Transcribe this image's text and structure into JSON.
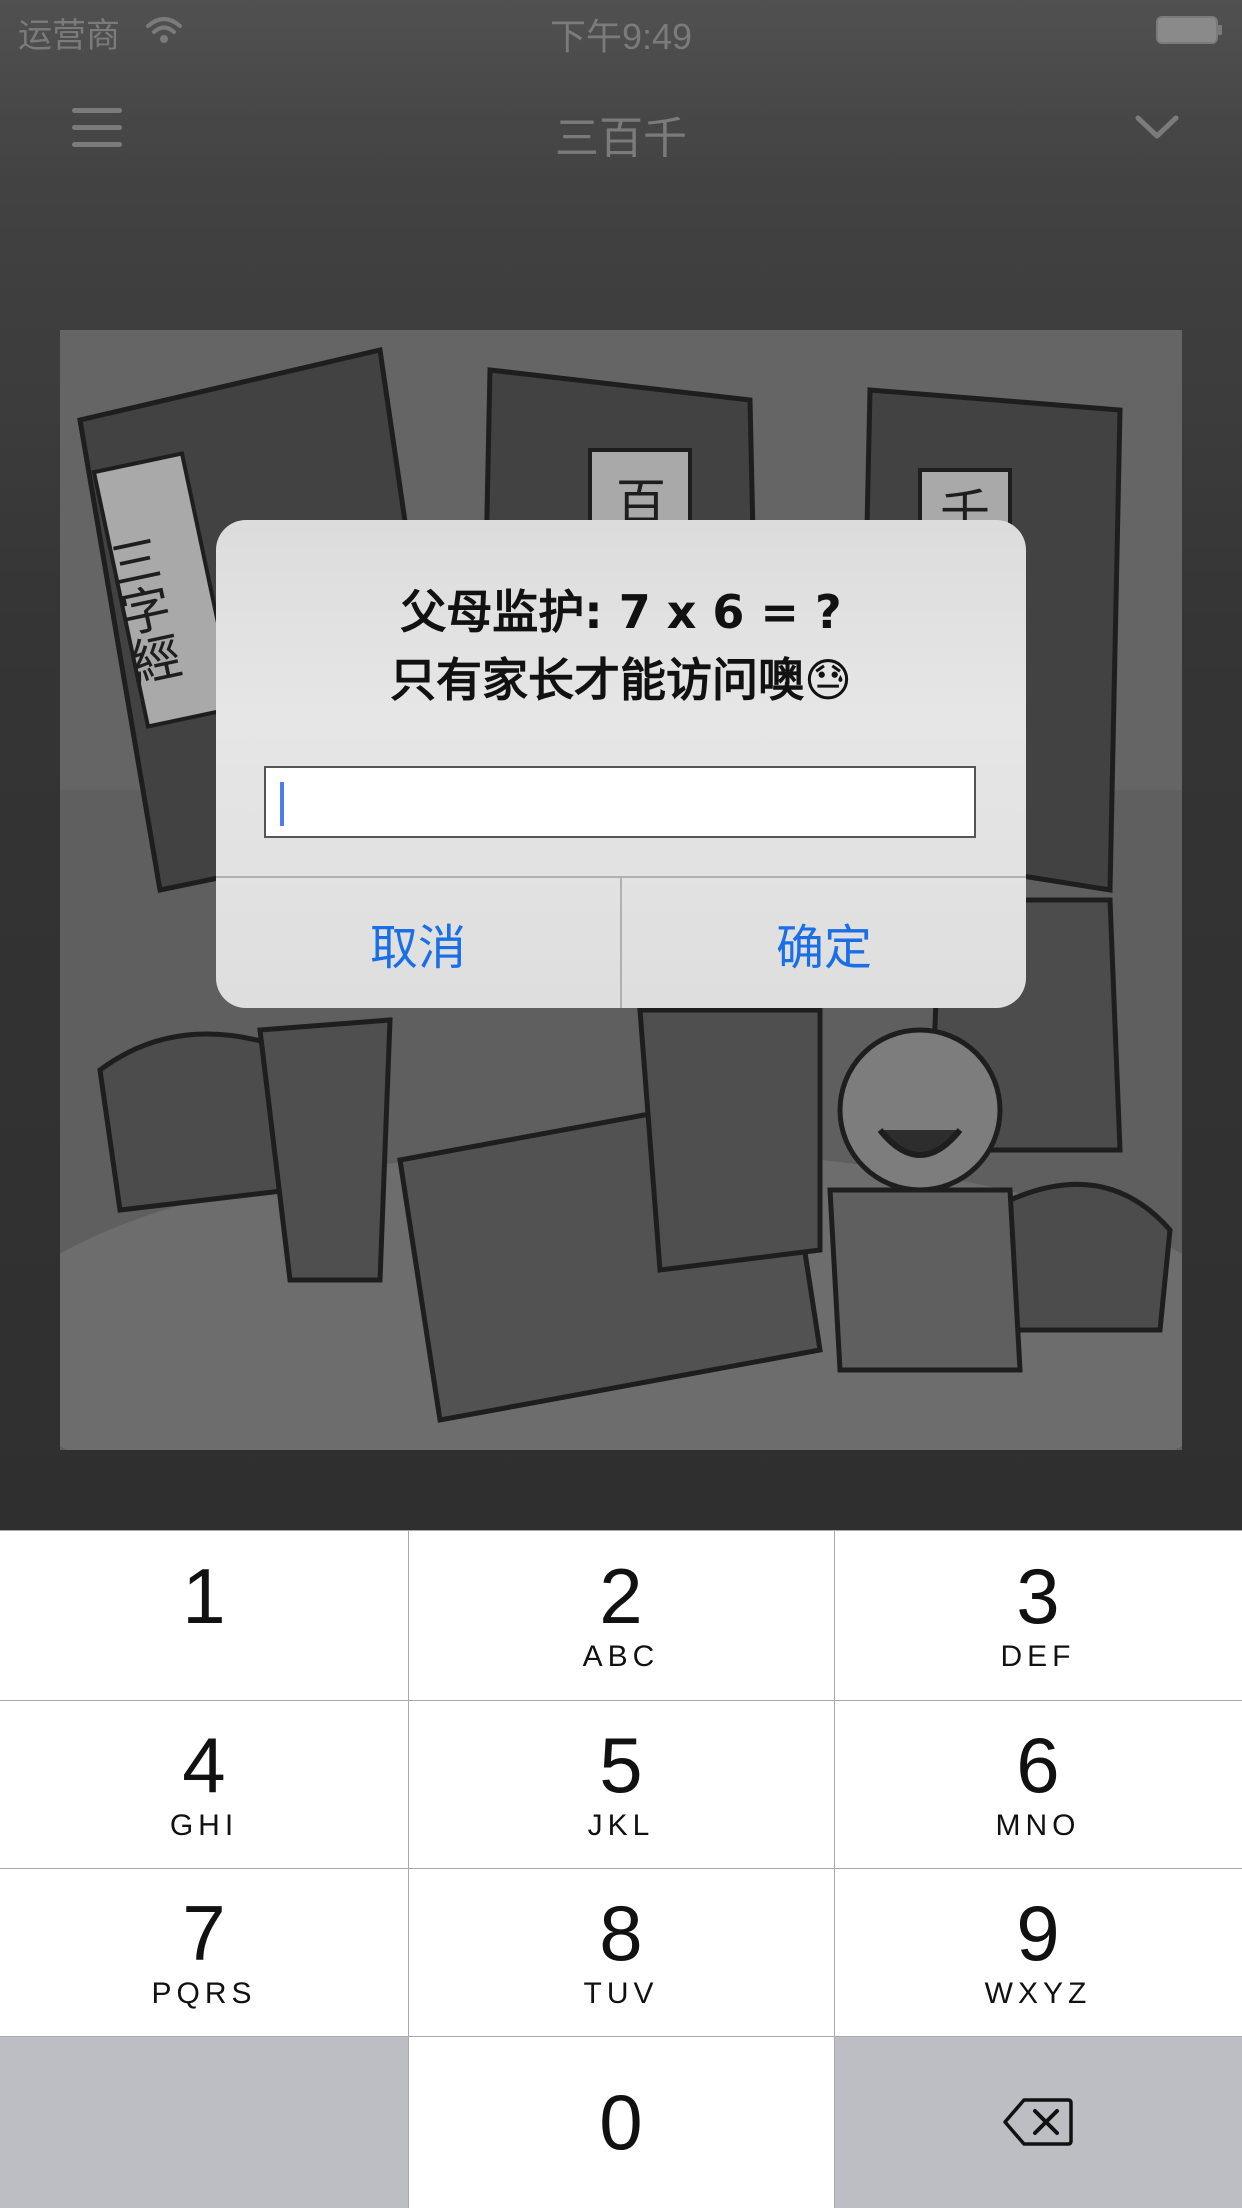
{
  "status_bar": {
    "carrier": "运营商",
    "time": "下午9:49"
  },
  "nav": {
    "title": "三百千",
    "menu_icon": "hamburger-menu-icon",
    "dropdown_icon": "chevron-down-icon"
  },
  "illustration": {
    "book_titles": [
      "三字經",
      "百",
      "千"
    ]
  },
  "alert": {
    "title_line1": "父母监护: 7 x 6 = ?",
    "title_line2": "只有家长才能访问噢😓",
    "input_value": "",
    "cancel_label": "取消",
    "confirm_label": "确定",
    "accent_color": "#1a6fe6"
  },
  "keypad": {
    "keys": [
      {
        "num": "1",
        "letters": ""
      },
      {
        "num": "2",
        "letters": "ABC"
      },
      {
        "num": "3",
        "letters": "DEF"
      },
      {
        "num": "4",
        "letters": "GHI"
      },
      {
        "num": "5",
        "letters": "JKL"
      },
      {
        "num": "6",
        "letters": "MNO"
      },
      {
        "num": "7",
        "letters": "PQRS"
      },
      {
        "num": "8",
        "letters": "TUV"
      },
      {
        "num": "9",
        "letters": "WXYZ"
      },
      {
        "num": "0",
        "letters": ""
      }
    ],
    "delete_icon": "backspace-icon"
  }
}
